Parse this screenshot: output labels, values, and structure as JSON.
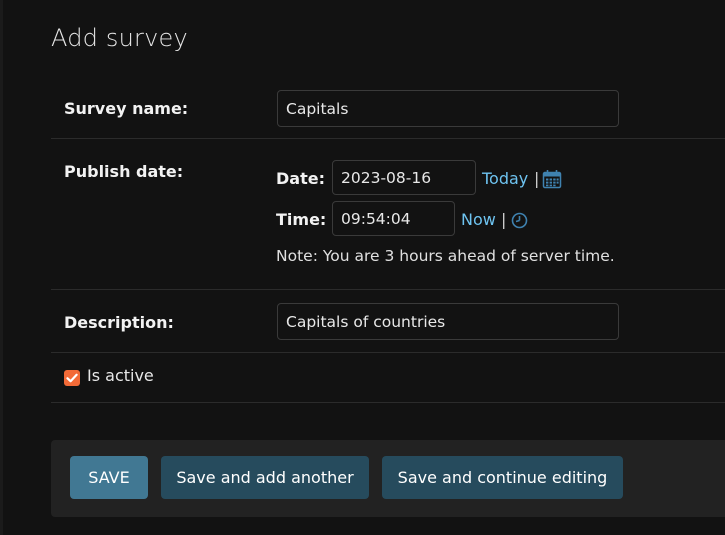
{
  "page": {
    "title": "Add survey"
  },
  "form": {
    "survey_name": {
      "label": "Survey name:",
      "value": "Capitals"
    },
    "publish_date": {
      "label": "Publish date:",
      "date_label": "Date:",
      "date_value": "2023-08-16",
      "today_link": "Today",
      "time_label": "Time:",
      "time_value": "09:54:04",
      "now_link": "Now",
      "separator": "|",
      "note": "Note: You are 3 hours ahead of server time.",
      "calendar_icon": "calendar-icon",
      "clock_icon": "clock-icon"
    },
    "description": {
      "label": "Description:",
      "value": "Capitals of countries"
    },
    "is_active": {
      "label": "Is active",
      "checked": true
    }
  },
  "actions": {
    "save": "SAVE",
    "save_add_another": "Save and add another",
    "save_continue": "Save and continue editing"
  },
  "colors": {
    "background": "#121212",
    "link": "#6ec3f0",
    "checkbox": "#f26a37",
    "primary_button": "#417893",
    "secondary_button": "#264b5d"
  }
}
